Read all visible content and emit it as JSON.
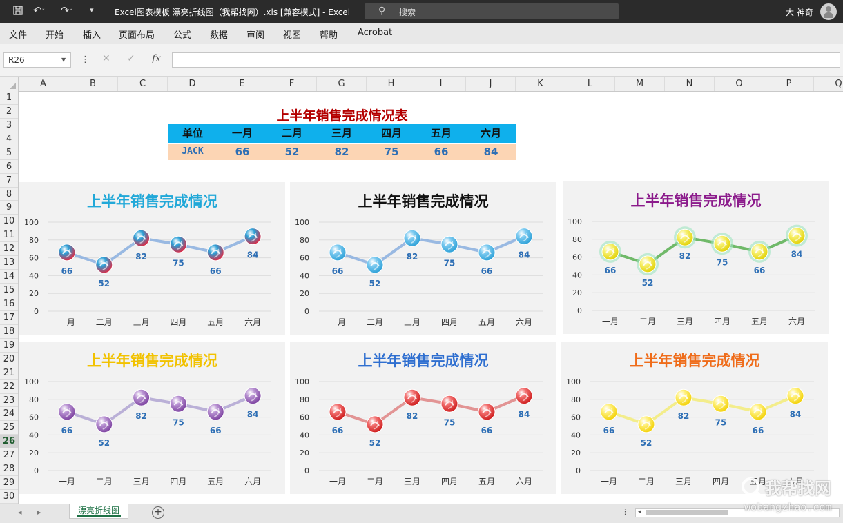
{
  "window": {
    "title": "Excel图表模板 漂亮折线图（我帮找网）.xls  [兼容模式]  -  Excel",
    "search_placeholder": "搜索",
    "user": "大 神奇"
  },
  "menu": [
    "文件",
    "开始",
    "插入",
    "页面布局",
    "公式",
    "数据",
    "审阅",
    "视图",
    "帮助",
    "Acrobat"
  ],
  "formula_bar": {
    "name_box": "R26",
    "formula": ""
  },
  "columns": [
    "A",
    "B",
    "C",
    "D",
    "E",
    "F",
    "G",
    "H",
    "I",
    "J",
    "K",
    "L",
    "M",
    "N",
    "O",
    "P",
    "Q"
  ],
  "rows": [
    "1",
    "2",
    "3",
    "4",
    "5",
    "6",
    "7",
    "8",
    "9",
    "10",
    "11",
    "12",
    "13",
    "14",
    "15",
    "16",
    "17",
    "18",
    "19",
    "20",
    "21",
    "22",
    "23",
    "24",
    "25",
    "26",
    "27",
    "28",
    "29",
    "30"
  ],
  "active_row": "26",
  "table": {
    "title": "上半年销售完成情况表",
    "headers": [
      "单位",
      "一月",
      "二月",
      "三月",
      "四月",
      "五月",
      "六月"
    ],
    "row": [
      "JACK",
      "66",
      "52",
      "82",
      "75",
      "66",
      "84"
    ]
  },
  "chart_data": [
    {
      "type": "line",
      "title": "上半年销售完成情况",
      "title_color": "#21a8d8",
      "categories": [
        "一月",
        "二月",
        "三月",
        "四月",
        "五月",
        "六月"
      ],
      "series": [
        {
          "values": [
            66,
            52,
            82,
            75,
            66,
            84
          ]
        }
      ],
      "yticks": [
        "0",
        "20",
        "40",
        "60",
        "80",
        "100"
      ],
      "ylim": [
        0,
        100
      ],
      "data_labels": [
        "66",
        "52",
        "82",
        "75",
        "66",
        "84"
      ],
      "line_color": "#8fb3e0",
      "marker_colors": [
        "#e8233b",
        "#2a9fd6"
      ]
    },
    {
      "type": "line",
      "title": "上半年销售完成情况",
      "title_color": "#111111",
      "categories": [
        "一月",
        "二月",
        "三月",
        "四月",
        "五月",
        "六月"
      ],
      "series": [
        {
          "values": [
            66,
            52,
            82,
            75,
            66,
            84
          ]
        }
      ],
      "yticks": [
        "0",
        "20",
        "40",
        "60",
        "80",
        "100"
      ],
      "ylim": [
        0,
        100
      ],
      "data_labels": [
        "66",
        "52",
        "82",
        "75",
        "66",
        "84"
      ],
      "line_color": "#8fb3e0",
      "marker_colors": [
        "#2a9fd6",
        "#7ccaf0"
      ]
    },
    {
      "type": "line",
      "title": "上半年销售完成情况",
      "title_color": "#8b1a8b",
      "categories": [
        "一月",
        "二月",
        "三月",
        "四月",
        "五月",
        "六月"
      ],
      "series": [
        {
          "values": [
            66,
            52,
            82,
            75,
            66,
            84
          ]
        }
      ],
      "yticks": [
        "0",
        "20",
        "40",
        "60",
        "80",
        "100"
      ],
      "ylim": [
        0,
        100
      ],
      "data_labels": [
        "66",
        "52",
        "82",
        "75",
        "66",
        "84"
      ],
      "line_color": "#62b35a",
      "marker_colors": [
        "#e0d000",
        "#f8f070"
      ]
    },
    {
      "type": "line",
      "title": "上半年销售完成情况",
      "title_color": "#f2c200",
      "categories": [
        "一月",
        "二月",
        "三月",
        "四月",
        "五月",
        "六月"
      ],
      "series": [
        {
          "values": [
            66,
            52,
            82,
            75,
            66,
            84
          ]
        }
      ],
      "yticks": [
        "0",
        "20",
        "40",
        "60",
        "80",
        "100"
      ],
      "ylim": [
        0,
        100
      ],
      "data_labels": [
        "66",
        "52",
        "82",
        "75",
        "66",
        "84"
      ],
      "line_color": "#b4a8d4",
      "marker_colors": [
        "#7a3e9d",
        "#b892d2"
      ]
    },
    {
      "type": "line",
      "title": "上半年销售完成情况",
      "title_color": "#2f6fd0",
      "categories": [
        "一月",
        "二月",
        "三月",
        "四月",
        "五月",
        "六月"
      ],
      "series": [
        {
          "values": [
            66,
            52,
            82,
            75,
            66,
            84
          ]
        }
      ],
      "yticks": [
        "0",
        "20",
        "40",
        "60",
        "80",
        "100"
      ],
      "ylim": [
        0,
        100
      ],
      "data_labels": [
        "66",
        "52",
        "82",
        "75",
        "66",
        "84"
      ],
      "line_color": "#e08a8a",
      "marker_colors": [
        "#cc1818",
        "#f27070"
      ]
    },
    {
      "type": "line",
      "title": "上半年销售完成情况",
      "title_color": "#ef6c1a",
      "categories": [
        "一月",
        "二月",
        "三月",
        "四月",
        "五月",
        "六月"
      ],
      "series": [
        {
          "values": [
            66,
            52,
            82,
            75,
            66,
            84
          ]
        }
      ],
      "yticks": [
        "0",
        "20",
        "40",
        "60",
        "80",
        "100"
      ],
      "ylim": [
        0,
        100
      ],
      "data_labels": [
        "66",
        "52",
        "82",
        "75",
        "66",
        "84"
      ],
      "line_color": "#f3ec80",
      "marker_colors": [
        "#f2cf00",
        "#fff07a"
      ]
    }
  ],
  "sheet_tabs": [
    "漂亮折线图"
  ],
  "watermark": {
    "text": "我帮找网",
    "url_text": "wobangzhao.com"
  }
}
